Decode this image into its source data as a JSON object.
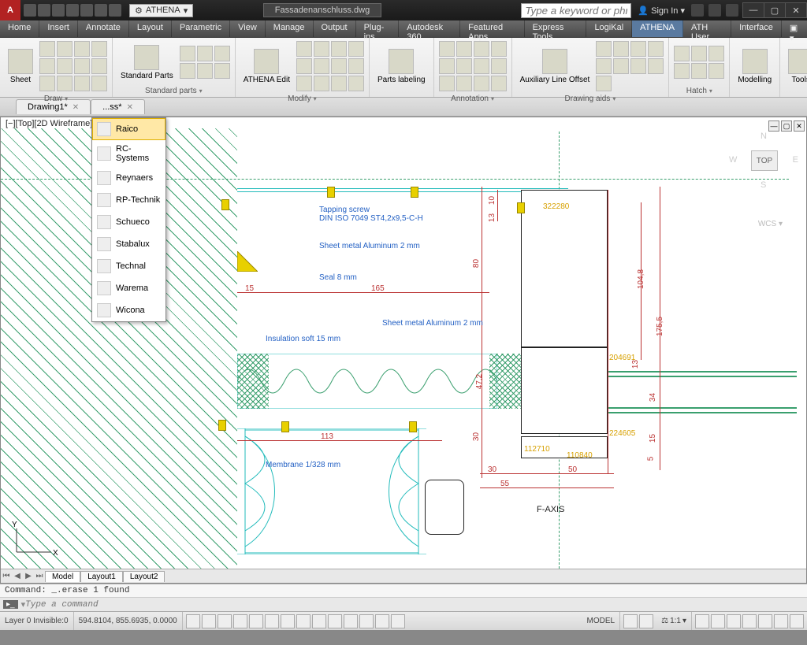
{
  "title": {
    "workspace": "ATHENA",
    "filename": "Fassadenanschluss.dwg",
    "search_placeholder": "Type a keyword or phrase",
    "signin": "Sign In"
  },
  "tabs": [
    "Home",
    "Insert",
    "Annotate",
    "Layout",
    "Parametric",
    "View",
    "Manage",
    "Output",
    "Plug-ins",
    "Autodesk 360",
    "Featured Apps",
    "Express Tools",
    "LogiKal",
    "ATHENA",
    "ATH User",
    "Interface"
  ],
  "active_tab_index": 13,
  "ribbon": {
    "panels": [
      {
        "label": "Draw",
        "drop": true,
        "big": [
          {
            "txt": "Sheet"
          }
        ],
        "grid": 12
      },
      {
        "label": "Standard parts",
        "drop": true,
        "big": [
          {
            "txt": "Standard Parts"
          }
        ],
        "grid": 6
      },
      {
        "label": "Modify",
        "drop": true,
        "big": [
          {
            "txt": "ATHENA Edit"
          }
        ],
        "grid": 12
      },
      {
        "label": "",
        "big": [
          {
            "txt": "Parts labeling"
          }
        ],
        "grid": 0
      },
      {
        "label": "Annotation",
        "drop": true,
        "grid": 12
      },
      {
        "label": "Drawing aids",
        "drop": true,
        "big": [
          {
            "txt": "Auxiliary Line Offset"
          }
        ],
        "grid": 9
      },
      {
        "label": "Hatch",
        "drop": true,
        "grid": 6
      },
      {
        "label": "",
        "big": [
          {
            "txt": "Modelling"
          }
        ]
      },
      {
        "label": "",
        "big": [
          {
            "txt": "Tools"
          }
        ]
      }
    ]
  },
  "doc_tabs": [
    "Drawing1*",
    "...ss*"
  ],
  "dropdown_items": [
    "Raico",
    "RC-Systems",
    "Reynaers",
    "RP-Technik",
    "Schueco",
    "Stabalux",
    "Technal",
    "Warema",
    "Wicona"
  ],
  "dropdown_selected": 0,
  "view_title": "[−][Top][2D Wireframe]",
  "nav": {
    "top": "TOP",
    "n": "N",
    "e": "E",
    "s": "S",
    "w": "W",
    "wcs": "WCS ▾"
  },
  "annotations": {
    "tap_screw": "Tapping screw\nDIN ISO 7049 ST4,2x9,5-C-H",
    "sheet_alu": "Sheet metal Aluminum 2 mm",
    "seal": "Seal 8 mm",
    "sheet_alu2": "Sheet metal Aluminum 2 mm",
    "insul": "Insulation soft 15 mm",
    "membrane": "Membrane 1/328 mm",
    "faxis": "F-AXIS"
  },
  "dims": {
    "d15": "15",
    "d165": "165",
    "d80": "80",
    "d13a": "13",
    "d10": "10",
    "d1048": "104,8",
    "d1755": "175,5",
    "d113": "113",
    "d30": "30",
    "d472": "47,2",
    "d30b": "30",
    "d50": "50",
    "d55": "55",
    "d34": "34",
    "d15b": "15",
    "d5": "5",
    "d13b": "13",
    "y322280": "322280",
    "y204691": "204691",
    "y224605": "224605",
    "y112710": "112710",
    "y110840": "110840"
  },
  "layout_tabs": [
    "Model",
    "Layout1",
    "Layout2"
  ],
  "cmd_history": "Command: _.erase 1 found",
  "cmd_placeholder": "Type a command",
  "status": {
    "layer": "Layer 0 Invisible:0",
    "coords": "594.8104, 855.6935, 0.0000",
    "model": "MODEL",
    "scale": "1:1"
  }
}
